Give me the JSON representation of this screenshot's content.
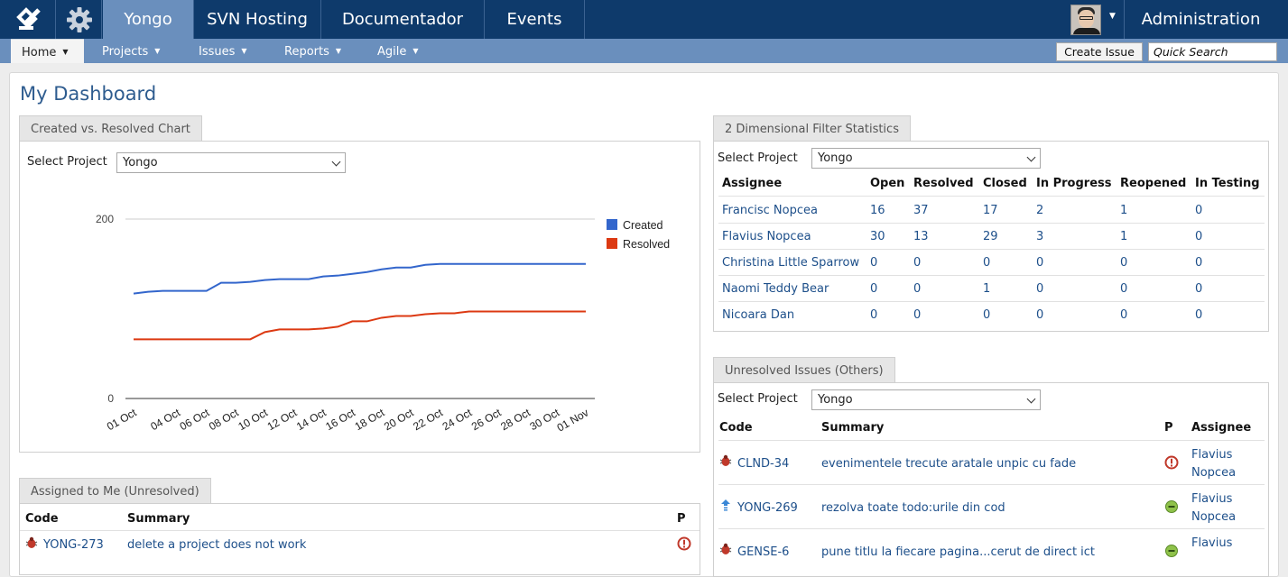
{
  "topbar": {
    "tabs": [
      {
        "label": "Yongo",
        "active": true
      },
      {
        "label": "SVN Hosting",
        "active": false
      },
      {
        "label": "Documentador",
        "active": false
      },
      {
        "label": "Events",
        "active": false
      }
    ],
    "admin_label": "Administration",
    "icons": {
      "logo": "yongo-logo-icon",
      "settings": "gear-icon",
      "user_menu": "chevron-down-icon"
    }
  },
  "subnav": {
    "items": [
      {
        "label": "Home",
        "active": true
      },
      {
        "label": "Projects",
        "active": false
      },
      {
        "label": "Issues",
        "active": false
      },
      {
        "label": "Reports",
        "active": false
      },
      {
        "label": "Agile",
        "active": false
      }
    ],
    "create_issue_label": "Create Issue",
    "quick_search_placeholder": "Quick Search"
  },
  "page": {
    "title": "My Dashboard"
  },
  "created_vs_resolved": {
    "tab_label": "Created vs. Resolved Chart",
    "select_label": "Select Project",
    "selected_project": "Yongo"
  },
  "chart_data": {
    "type": "line",
    "x": [
      "01 Oct",
      "02 Oct",
      "03 Oct",
      "04 Oct",
      "05 Oct",
      "06 Oct",
      "07 Oct",
      "08 Oct",
      "09 Oct",
      "10 Oct",
      "11 Oct",
      "12 Oct",
      "13 Oct",
      "14 Oct",
      "15 Oct",
      "16 Oct",
      "17 Oct",
      "18 Oct",
      "19 Oct",
      "20 Oct",
      "21 Oct",
      "22 Oct",
      "23 Oct",
      "24 Oct",
      "25 Oct",
      "26 Oct",
      "27 Oct",
      "28 Oct",
      "29 Oct",
      "30 Oct",
      "31 Oct",
      "01 Nov"
    ],
    "tick_labels": [
      "01 Oct",
      "04 Oct",
      "06 Oct",
      "08 Oct",
      "10 Oct",
      "12 Oct",
      "14 Oct",
      "16 Oct",
      "18 Oct",
      "20 Oct",
      "22 Oct",
      "24 Oct",
      "26 Oct",
      "28 Oct",
      "30 Oct",
      "01 Nov"
    ],
    "series": [
      {
        "name": "Created",
        "color": "#3366cc",
        "values": [
          117,
          119,
          120,
          120,
          120,
          120,
          129,
          129,
          130,
          132,
          133,
          133,
          133,
          136,
          137,
          139,
          141,
          144,
          146,
          146,
          149,
          150,
          150,
          150,
          150,
          150,
          150,
          150,
          150,
          150,
          150,
          150
        ]
      },
      {
        "name": "Resolved",
        "color": "#dc3912",
        "values": [
          66,
          66,
          66,
          66,
          66,
          66,
          66,
          66,
          66,
          74,
          77,
          77,
          77,
          78,
          80,
          86,
          86,
          90,
          92,
          92,
          94,
          95,
          95,
          97,
          97,
          97,
          97,
          97,
          97,
          97,
          97,
          97
        ]
      }
    ],
    "y_ticks": [
      "0",
      "200"
    ],
    "ylim": [
      0,
      200
    ],
    "grid": true,
    "legend": "right"
  },
  "filter_stats": {
    "tab_label": "2 Dimensional Filter Statistics",
    "select_label": "Select Project",
    "selected_project": "Yongo",
    "columns": [
      "Assignee",
      "Open",
      "Resolved",
      "Closed",
      "In Progress",
      "Reopened",
      "In Testing"
    ],
    "rows": [
      [
        "Francisc Nopcea",
        "16",
        "37",
        "17",
        "2",
        "1",
        "0"
      ],
      [
        "Flavius Nopcea",
        "30",
        "13",
        "29",
        "3",
        "1",
        "0"
      ],
      [
        "Christina Little Sparrow",
        "0",
        "0",
        "0",
        "0",
        "0",
        "0"
      ],
      [
        "Naomi Teddy Bear",
        "0",
        "0",
        "1",
        "0",
        "0",
        "0"
      ],
      [
        "Nicoara Dan",
        "0",
        "0",
        "0",
        "0",
        "0",
        "0"
      ]
    ]
  },
  "unresolved_others": {
    "tab_label": "Unresolved Issues (Others)",
    "select_label": "Select Project",
    "selected_project": "Yongo",
    "columns": [
      "Code",
      "Summary",
      "P",
      "Assignee"
    ],
    "rows": [
      {
        "type_icon": "bug-icon",
        "code": "CLND-34",
        "summary": "evenimentele trecute aratale unpic cu fade",
        "priority_icon": "priority-critical-icon",
        "assignee": "Flavius Nopcea",
        "assignee_line1": "Flavius",
        "assignee_line2": "Nopcea"
      },
      {
        "type_icon": "improvement-icon",
        "code": "YONG-269",
        "summary": "rezolva toate todo:urile din cod",
        "priority_icon": "priority-minor-icon",
        "assignee": "Flavius Nopcea",
        "assignee_line1": "Flavius",
        "assignee_line2": "Nopcea"
      },
      {
        "type_icon": "bug-icon",
        "code": "GENSE-6",
        "summary": "pune titlu la fiecare pagina...cerut de direct ict",
        "priority_icon": "priority-minor-icon",
        "assignee": "Flavius",
        "assignee_line1": "Flavius",
        "assignee_line2": ""
      }
    ]
  },
  "assigned_to_me": {
    "tab_label": "Assigned to Me (Unresolved)",
    "columns": [
      "Code",
      "Summary",
      "P"
    ],
    "rows": [
      {
        "type_icon": "bug-icon",
        "code": "YONG-273",
        "summary": "delete a project does not work",
        "priority_icon": "priority-critical-icon"
      }
    ]
  }
}
